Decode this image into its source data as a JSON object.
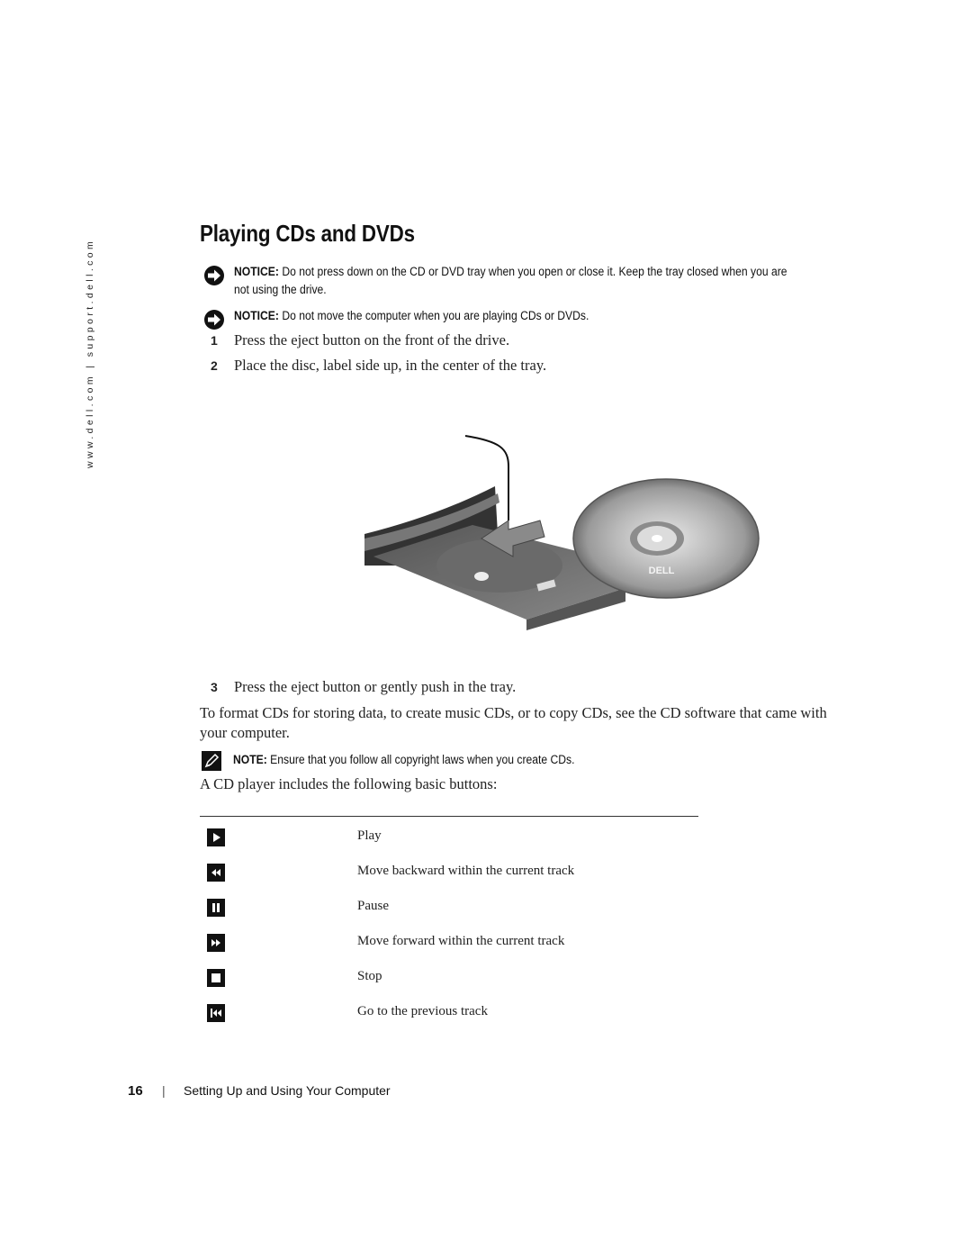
{
  "sidebar": {
    "url_text": "www.dell.com | support.dell.com"
  },
  "page": {
    "title": "Playing CDs and DVDs",
    "notices": [
      {
        "icon": "notice-arrow-icon",
        "label": "NOTICE:",
        "text": " Do not press down on the CD or DVD tray when you open or close it. Keep the tray closed when you are not using the drive."
      },
      {
        "icon": "notice-arrow-icon",
        "label": "NOTICE:",
        "text": " Do not move the computer when you are playing CDs or DVDs."
      }
    ],
    "steps": [
      {
        "num": "1",
        "text": "Press the eject button on the front of the drive."
      },
      {
        "num": "2",
        "text": "Place the disc, label side up, in the center of the tray."
      },
      {
        "num": "3",
        "text": "Press the eject button or gently push in the tray."
      }
    ],
    "figure": {
      "description": "Disc being placed into open CD/DVD drive tray",
      "disc_logo": "DELL"
    },
    "format_paragraph": "To format CDs for storing data, to create music CDs, or to copy CDs, see the CD software that came with your computer.",
    "note": {
      "icon": "note-pencil-icon",
      "label": "NOTE:",
      "text": " Ensure that you follow all copyright laws when you create CDs."
    },
    "buttons_intro": "A CD player includes the following basic buttons:",
    "buttons": [
      {
        "icon": "play-icon",
        "label": "Play"
      },
      {
        "icon": "rewind-icon",
        "label": "Move backward within the current track"
      },
      {
        "icon": "pause-icon",
        "label": "Pause"
      },
      {
        "icon": "fast-forward-icon",
        "label": "Move forward within the current track"
      },
      {
        "icon": "stop-icon",
        "label": "Stop"
      },
      {
        "icon": "previous-track-icon",
        "label": "Go to the previous track"
      }
    ]
  },
  "footer": {
    "page_number": "16",
    "separator": "|",
    "section": "Setting Up and Using Your Computer"
  }
}
